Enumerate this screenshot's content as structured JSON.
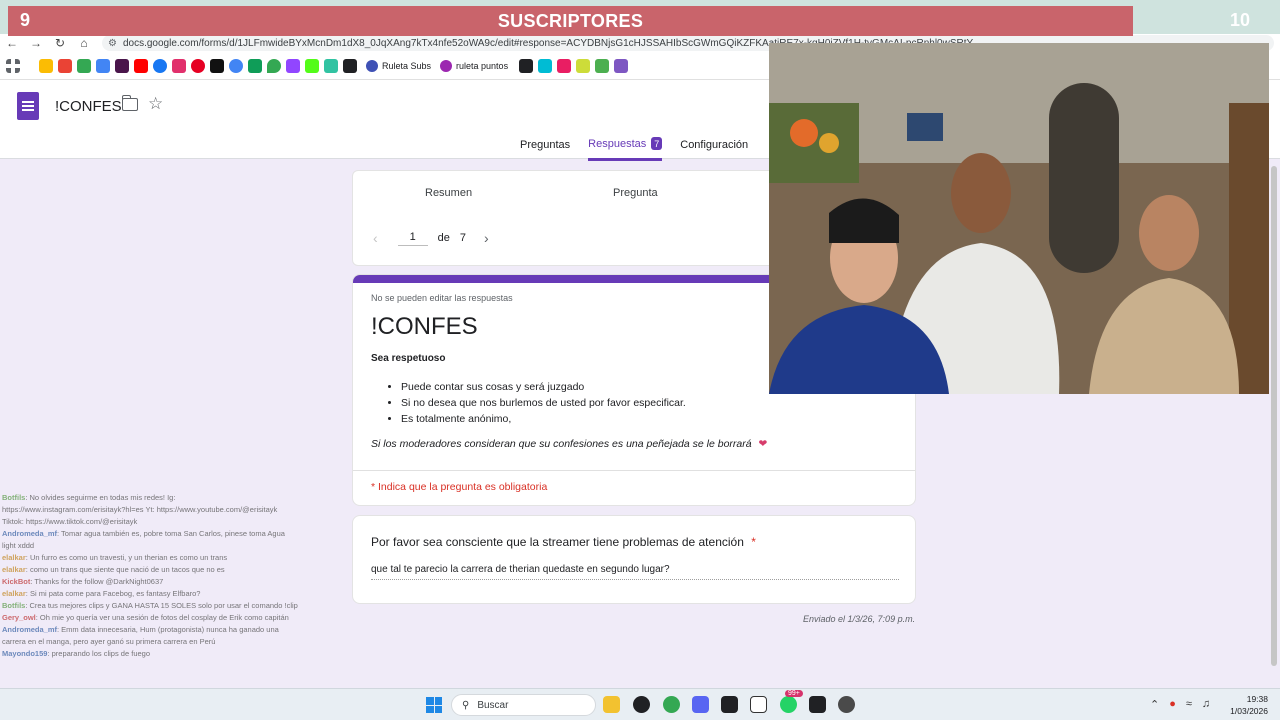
{
  "browser": {
    "url": "docs.google.com/forms/d/1JLFmwideBYxMcnDm1dX8_0JqXAng7kTx4nfe52oWA9c/edit#response=ACYDBNjsG1cHJSSAHIbScGWmGQiKZFKAatiRE7x-kqH0iZVf1H-tvGMcAI-pcRnhl0wSRtY",
    "bookmarks": [
      {
        "label": "Ruleta Subs",
        "icon": "ruleta-icon",
        "color": "#3f51b5"
      },
      {
        "label": "ruleta puntos",
        "icon": "puntos-icon",
        "color": "#9c27b0"
      }
    ]
  },
  "banner": {
    "current": "9",
    "label": "SUSCRIPTORES",
    "goal": "10",
    "color": "#c9646b"
  },
  "forms": {
    "title": "!CONFES",
    "tabs": [
      {
        "label": "Preguntas",
        "active": false
      },
      {
        "label": "Respuestas",
        "active": true,
        "badge": "7"
      },
      {
        "label": "Configuración",
        "active": false
      }
    ],
    "subtabs": [
      "Resumen",
      "Pregunta"
    ],
    "pager": {
      "current": "1",
      "of": "de",
      "total": "7"
    },
    "accent": "#673ab7"
  },
  "form_card": {
    "no_edit": "No se pueden editar las respuestas",
    "title": "!CONFES",
    "subtitle": "Sea respetuoso",
    "rules": [
      "Puede contar sus cosas y será juzgado",
      "Si no desea que nos burlemos de usted por favor especificar.",
      "Es totalmente anónimo,"
    ],
    "footnote": "Si los moderadores consideran que su confesiones es una peñejada se le borrará",
    "heart": "❤",
    "required_note": "* Indica que la pregunta es obligatoria"
  },
  "question": {
    "label": "Por favor sea consciente que la streamer tiene problemas de atención",
    "required_mark": "*",
    "answer": "que tal te parecio la carrera de therian quedaste en segundo lugar?",
    "submitted": "Enviado el 1/3/26, 7:09 p.m."
  },
  "chat": [
    {
      "user": "Botfils",
      "text": ": No olvides seguirme en todas mis redes! Ig: https://www.instagram.com/erisitayk?hl=es Yt: https://www.youtube.com/@erisitayk Tiktok: https://www.tiktok.com/@erisitayk",
      "tone": ""
    },
    {
      "user": "Andromeda_mf",
      "text": ": Tomar agua también es, pobre toma San Carlos, pinese toma Agua light xddd",
      "tone": "b"
    },
    {
      "user": "elalkar",
      "text": ": Un furro es como un travesti, y un therian es como un trans",
      "tone": "o"
    },
    {
      "user": "elalkar",
      "text": ": como un trans que siente que nació de un tacos que no es",
      "tone": "o"
    },
    {
      "user": "KickBot",
      "text": ": Thanks for the follow @DarkNight0637",
      "tone": "r"
    },
    {
      "user": "elalkar",
      "text": ": Si mi pata come para Facebog, es fantasy Elfbaro?",
      "tone": "o"
    },
    {
      "user": "Botfils",
      "text": ": Crea tus mejores clips y GANA HASTA 15 SOLES solo por usar el comando !clip",
      "tone": ""
    },
    {
      "user": "Gery_owl",
      "text": ": Oh mie yo quería ver una sesión de fotos del cosplay de Erik como capitán",
      "tone": "r"
    },
    {
      "user": "Andromeda_mf",
      "text": ": Emm data innecesaria, Hum (protagonista) nunca ha ganado una carrera en el manga, pero ayer ganó su primera carrera en Perú",
      "tone": "b"
    },
    {
      "user": "Mayondo159",
      "text": ": preparando los clips de fuego",
      "tone": "b"
    }
  ],
  "taskbar": {
    "search_placeholder": "Buscar",
    "badge": "99+",
    "time": "19:38",
    "date": "1/03/2026"
  }
}
